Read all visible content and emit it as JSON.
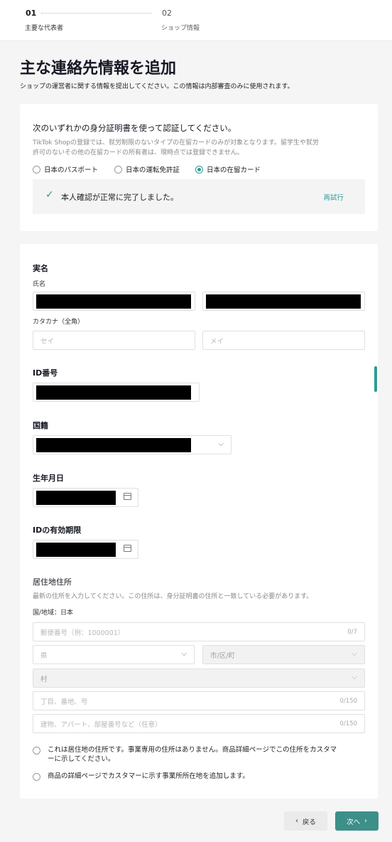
{
  "steps": [
    {
      "num": "01",
      "label": "主要な代表者"
    },
    {
      "num": "02",
      "label": "ショップ情報"
    }
  ],
  "page": {
    "title": "主な連絡先情報を追加",
    "subtitle": "ショップの運営者に関する情報を提出してください。この情報は内部審査のみに使用されます。"
  },
  "identity": {
    "heading": "次のいずれかの身分証明書を使って認証してください。",
    "note_line1": "TikTok Shopの登録では、就労制限のないタイプの在留カードのみが対象となります。留学生や就労",
    "note_line2": "許可のないその他の在留カードの所有者は、現時点では登録できません。",
    "options": [
      "日本のパスポート",
      "日本の運転免許証",
      "日本の在留カード"
    ],
    "selected": "日本の在留カード",
    "verified_text": "本人確認が正常に完了しました。",
    "retry_label": "再試行"
  },
  "form": {
    "real_name_heading": "実名",
    "full_name_label": "氏名",
    "katakana_label": "カタカナ（全角）",
    "katakana_first_placeholder": "セイ",
    "katakana_last_placeholder": "メイ",
    "id_number_label": "ID番号",
    "nationality_label": "国籍",
    "birth_date_label": "生年月日",
    "id_expiry_label": "IDの有効期限",
    "address_heading": "居住地住所",
    "address_note": "最新の住所を入力してください。この住所は、身分証明書の住所と一致している必要があります。",
    "country_label": "国/地域：日本",
    "postal_placeholder": "郵便番号（例：1000001）",
    "postal_counter": "0/7",
    "prefecture_placeholder": "県",
    "city_placeholder": "市/区/町",
    "village_placeholder": "村",
    "street_placeholder": "丁目、番地、号",
    "street_counter": "0/150",
    "building_placeholder": "建物、アパート、部屋番号など（任意）",
    "building_counter": "0/150",
    "option_residential_line1": "これは居住地の住所です。事業専用の住所はありません。商品詳細ページでこの住所をカスタマ",
    "option_residential_line2": "ーに示してください。",
    "option_business": "商品の詳細ページでカスタマーに示す事業所所在地を追加します。"
  },
  "footer": {
    "back_label": "戻る",
    "next_label": "次へ"
  },
  "colors": {
    "accent": "#2f9a94",
    "next_button": "#3d8f89"
  }
}
